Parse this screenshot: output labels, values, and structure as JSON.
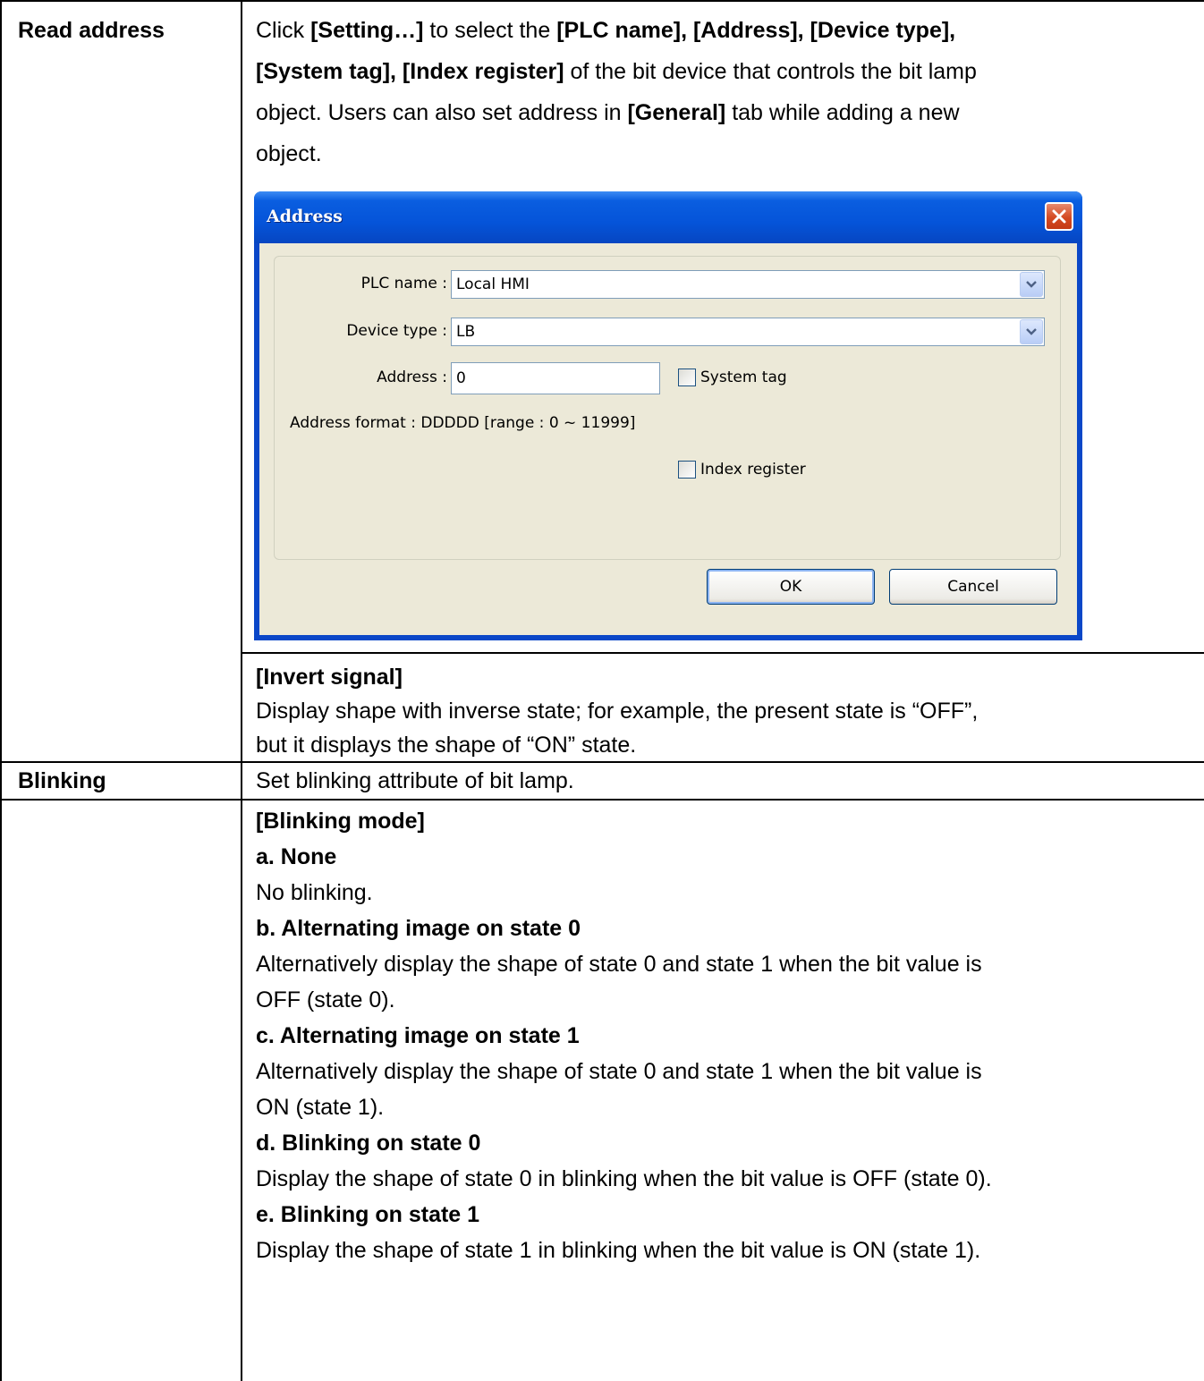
{
  "table": {
    "rows": [
      {
        "label": "Read address",
        "intro": {
          "line1": {
            "a": "Click ",
            "b": "[Setting…]",
            "c": " to select the ",
            "d": "[PLC name], [Address], [Device type],"
          },
          "line2": {
            "a": "[System tag], [Index register]",
            "b": " of the bit device that controls the bit lamp"
          },
          "line3": {
            "a": "object. Users can also set address in ",
            "b": "[General]",
            "c": " tab while adding a new"
          },
          "line4": "object."
        },
        "invert": {
          "heading": "[Invert signal]",
          "line1": "Display shape with inverse state; for example, the present state is “OFF”,",
          "line2": "but it displays the shape of “ON” state."
        }
      },
      {
        "label": "Blinking",
        "text": "Set blinking attribute of bit lamp."
      },
      {
        "label": "",
        "heading": "[Blinking mode]",
        "items": [
          {
            "title": "a. None",
            "lines": [
              "No blinking."
            ]
          },
          {
            "title": "b. Alternating image on state 0",
            "lines": [
              "Alternatively display the shape of state 0 and state 1 when the bit value is",
              "OFF (state 0)."
            ]
          },
          {
            "title": "c. Alternating image on state 1",
            "lines": [
              "Alternatively display the shape of state 0 and state 1 when the bit value is",
              "ON (state 1)."
            ]
          },
          {
            "title": "d. Blinking on state 0",
            "lines": [
              "Display the shape of state 0 in blinking when the bit value is OFF (state 0)."
            ]
          },
          {
            "title": "e. Blinking on state 1",
            "lines": [
              "Display the shape of state 1 in blinking when the bit value is ON (state 1)."
            ]
          }
        ]
      }
    ]
  },
  "dialog": {
    "title": "Address",
    "plc_name_label": "PLC name :",
    "plc_name_value": "Local HMI",
    "device_type_label": "Device type :",
    "device_type_value": "LB",
    "address_label": "Address :",
    "address_value": "0",
    "system_tag_label": "System tag",
    "address_format": "Address format : DDDDD [range : 0 ~ 11999]",
    "index_register_label": "Index register",
    "ok_label": "OK",
    "cancel_label": "Cancel",
    "colors": {
      "titlebar": "#0554d9",
      "client": "#ece9d8",
      "close": "#d44a22"
    }
  }
}
